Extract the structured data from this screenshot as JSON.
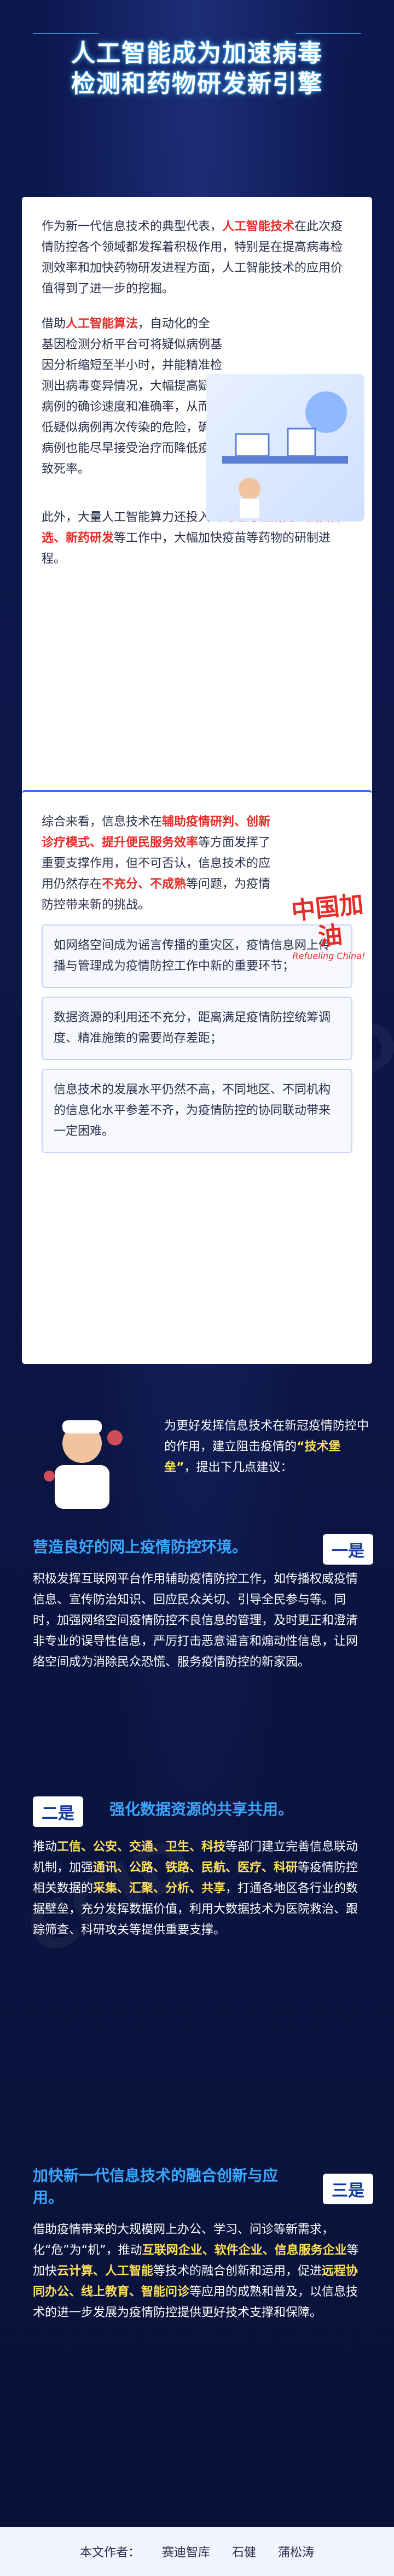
{
  "title": {
    "line1": "人工智能成为加速病毒",
    "line2": "检测和药物研发新引擎"
  },
  "panel_a": {
    "p1_pre": "作为新一代信息技术的典型代表，",
    "p1_hl1": "人工智能技术",
    "p1_post": "在此次疫情防控各个领域都发挥着积极作用，特别是在提高病毒检测效率和加快药物研发进程方面，人工智能技术的应用价值得到了进一步的挖掘。",
    "p2_pre": "借助",
    "p2_hl": "人工智能算法",
    "p2_mid": "，自动化的全基因检测分析平台可将疑似病例基因分析缩短至半小时，并能精准检测出病毒变异情况，大幅提高疑似病例的确诊速度和准确率，从而降低疑似病例再次传染的危险，确诊病例也能尽早接受治疗而降低疫情致死率。",
    "p3_pre": "此外，大量人工智能算力还投入到",
    "p3_hl": "药理毒理研究、蛋白筛选、新药研发",
    "p3_post": "等工作中，大幅加快疫苗等药物的研制进程。"
  },
  "panel_b": {
    "intro_pre": "综合来看，信息技术在",
    "intro_hl": "辅助疫情研判、创新诊疗模式、提升便民服务效率",
    "intro_mid": "等方面发挥了重要支撑作用，但不可否认，信息技术的应用仍然存在",
    "intro_hl2": "不充分、不成熟",
    "intro_post": "等问题，为疫情防控带来新的挑战。",
    "badge_cn": "中国加油",
    "badge_en": "Refueling China!",
    "box1": "如网络空间成为谣言传播的重灾区，疫情信息网上传播与管理成为疫情防控工作中新的重要环节；",
    "box2": "数据资源的利用还不充分，距离满足疫情防控统筹调度、精准施策的需要尚存差距；",
    "box3": "信息技术的发展水平仍然不高，不同地区、不同机构的信息化水平参差不齐，为疫情防控的协同联动带来一定困难。"
  },
  "intro_dark": {
    "pre": "为更好发挥信息技术在新冠疫情防控中的作用，建立阻击疫情的",
    "hl": "“技术堡垒”",
    "post": "，提出下几点建议："
  },
  "sec1": {
    "heading": "营造良好的网上疫情防控环境。",
    "num": "一是",
    "body": "积极发挥互联网平台作用辅助疫情防控工作，如传播权威疫情信息、宣传防治知识、回应民众关切、引导全民参与等。同时，加强网络空间疫情防控不良信息的管理，及时更正和澄清非专业的误导性信息，严厉打击恶意谣言和煽动性信息，让网络空间成为消除民众恐慌、服务疫情防控的新家园。"
  },
  "sec2": {
    "num": "二是",
    "heading": "强化数据资源的共享共用。",
    "body_pre": "推动",
    "body_hl1": "工信、公安、交通、卫生、科技",
    "body_mid1": "等部门建立完善信息联动机制，加强",
    "body_hl2": "通讯、公路、铁路、民航、医疗、科研",
    "body_mid2": "等疫情防控相关数据的",
    "body_hl3": "采集、汇聚、分析、共享",
    "body_post": "，打通各地区各行业的数据壁垒，充分发挥数据价值，利用大数据技术为医院救治、跟踪筛查、科研攻关等提供重要支撑。"
  },
  "sec3": {
    "heading": "加快新一代信息技术的融合创新与应用。",
    "num": "三是",
    "body_pre": "借助疫情带来的大规模网上办公、学习、问诊等新需求，化“危”为“机”，推动",
    "body_hl1": "互联网企业、软件企业、信息服务企业",
    "body_mid1": "等加快",
    "body_hl2": "云计算、人工智能",
    "body_mid2": "等技术的融合创新和运用，促进",
    "body_hl3": "远程协同办公、线上教育、智能问诊",
    "body_post": "等应用的成熟和普及，以信息技术的进一步发展为疫情防控提供更好技术支撑和保障。"
  },
  "footer": {
    "label": "本文作者：",
    "author1": "赛迪智库",
    "author2": "石健",
    "author3": "蒲松涛"
  },
  "watermark": "CCID"
}
